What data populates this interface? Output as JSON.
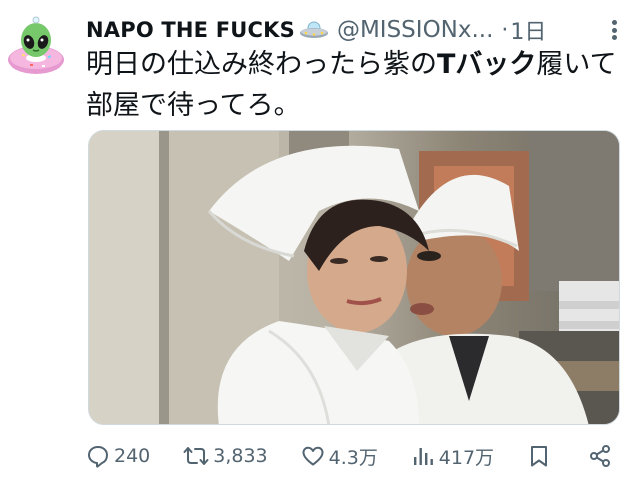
{
  "tweet": {
    "display_name": "NAPO THE FUCKS",
    "handle": "@MISSIONx...",
    "separator": "·",
    "time": "1日",
    "text_line1_a": "明日の仕込み終わったら紫の",
    "text_line1_b": "Tバック",
    "text_line1_c": "履いて",
    "text_line2": "部屋で待ってろ。"
  },
  "actions": {
    "replies": "240",
    "retweets": "3,833",
    "likes": "4.3万",
    "views": "417万"
  },
  "icons": {
    "avatar": "alien-donut-avatar",
    "badge": "ufo-icon",
    "more": "more-icon",
    "reply": "reply-icon",
    "retweet": "retweet-icon",
    "like": "heart-icon",
    "views": "views-icon",
    "bookmark": "bookmark-icon",
    "share": "share-icon"
  },
  "colors": {
    "text": "#0f1419",
    "secondary": "#536471"
  }
}
